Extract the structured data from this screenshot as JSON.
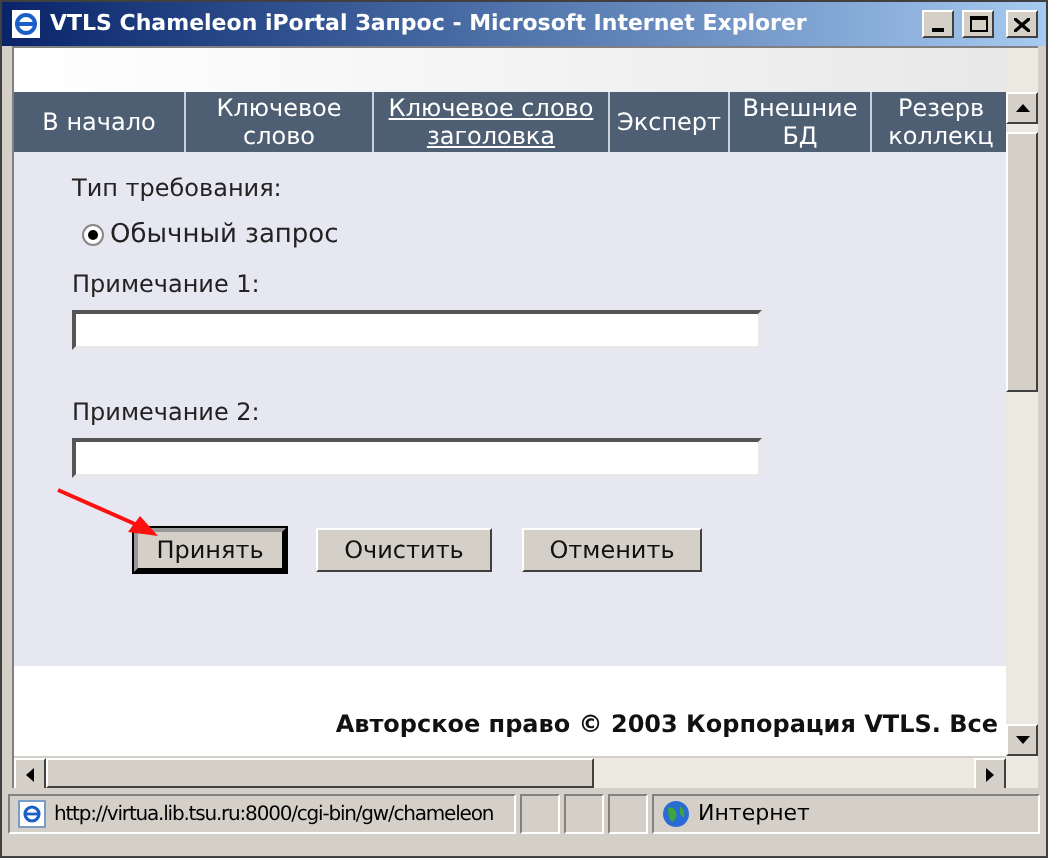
{
  "window": {
    "title": "VTLS Chameleon iPortal Запрос - Microsoft Internet Explorer"
  },
  "nav": [
    {
      "label": "В начало",
      "selected": false
    },
    {
      "label": "Ключевое слово",
      "selected": false
    },
    {
      "label": "Ключевое слово заголовка",
      "selected": true
    },
    {
      "label": "Эксперт",
      "selected": false
    },
    {
      "label": "Внешние БД",
      "selected": false
    },
    {
      "label": "Резерв коллекц",
      "selected": false
    }
  ],
  "form": {
    "request_type_label": "Тип требования:",
    "radios": [
      {
        "label": "Обычный запрос",
        "selected": true
      }
    ],
    "fields": [
      {
        "label": "Примечание 1:"
      },
      {
        "label": "Примечание 2:"
      }
    ],
    "buttons": [
      {
        "label": "Принять",
        "focused": true
      },
      {
        "label": "Очистить",
        "focused": false
      },
      {
        "label": "Отменить",
        "focused": false
      }
    ]
  },
  "copyright": "Авторское право © 2003 Корпорация VTLS. Все",
  "status_bar": {
    "url": "http://virtua.lib.tsu.ru:8000/cgi-bin/gw/chameleon",
    "zone": "Интернет"
  }
}
